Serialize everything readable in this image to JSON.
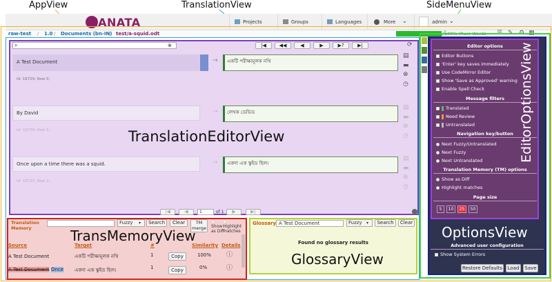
{
  "annotations": {
    "app_view": "AppView",
    "translation_view": "TranslationView",
    "side_menu_view": "SideMenuView",
    "translation_editor_view": "TranslationEditorView",
    "trans_memory_view": "TransMemoryView",
    "glossary_view": "GlossaryView",
    "editor_options_view": "EditorOptionsView",
    "options_view": "OptionsView"
  },
  "header": {
    "logo": "ZANATA",
    "nav": [
      "Projects",
      "Groups",
      "Languages",
      "More"
    ],
    "user": "admin"
  },
  "breadcrumb": {
    "project": "raw-test",
    "version": "1.0",
    "documents": "Documents (bn-IN)",
    "file": "test/a-squid.odt",
    "sep": "/",
    "stats": "100% (Run) Words"
  },
  "editor": {
    "search_placeholder": "",
    "nav_buttons": [
      "|◀",
      "◀◀",
      "◀",
      "▶",
      "▶?",
      "▶|"
    ],
    "rows": [
      {
        "source": "A Test Document",
        "target": "একটি পরীক্ষামূলক নথি",
        "info": "Id: 16729; Row 0;"
      },
      {
        "source": "By David",
        "target": "লেখক ডেভিড",
        "info": "Id: 16730; Row 1;"
      },
      {
        "source": "Once upon a time there was a squid.",
        "target": "একদা এক স্কুইড ছিল।",
        "info": "Id: 16731; Row 2;"
      }
    ],
    "pager": {
      "page": "1",
      "of": "of 1"
    }
  },
  "tm": {
    "title": "Translation Memory",
    "search_value": "",
    "mode": "Fuzzy",
    "search_btn": "Search",
    "clear_btn": "Clear",
    "merge_btn": "TM merge",
    "show_diff": "Show as Diff",
    "highlight": "Highlight matches",
    "columns": [
      "Source",
      "Target",
      "#",
      "Similarity",
      "Details"
    ],
    "rows": [
      {
        "source": "A Test Document",
        "target": "একটি পরীক্ষামূলক নথি",
        "count": "1",
        "copy": "Copy",
        "similarity": "100%"
      },
      {
        "source_del": "A Test Document",
        "source_ins": "Once",
        "target": "একদা এক স্কুইড ছিল।",
        "count": "1",
        "copy": "Copy",
        "similarity": "0%"
      }
    ]
  },
  "glossary": {
    "title": "Glossary",
    "search_value": "A Test Document",
    "mode": "Fuzzy",
    "search_btn": "Search",
    "clear_btn": "Clear",
    "empty": "Found no glossary results"
  },
  "options": {
    "editor_options_header": "Editor options",
    "editor_options": [
      "Editor Buttons",
      "'Enter' key saves immediately",
      "Use CodeMirror Editor",
      "Show 'Save as Approved' warning",
      "Enable Spell Check"
    ],
    "message_filters_header": "Message filters",
    "message_filters": [
      "Translated",
      "Need Review",
      "Untranslated"
    ],
    "filter_colors": [
      "#5dbb63",
      "#f29b30",
      "#bbbbbb"
    ],
    "nav_header": "Navigation key/button",
    "nav_options": [
      "Next Fuzzy/Untranslated",
      "Next Fuzzy",
      "Next Untranslated"
    ],
    "tm_header": "Translation Memory (TM) options",
    "tm_options": [
      "Show as Diff",
      "Highlight matches"
    ],
    "page_size_header": "Page size",
    "page_sizes": [
      "5",
      "10",
      "25",
      "50"
    ],
    "advanced_header": "Advanced user configuration",
    "advanced_options": [
      "Show System Errors"
    ],
    "restore_btn": "Restore Defaults",
    "load_btn": "Load",
    "save_btn": "Save"
  }
}
